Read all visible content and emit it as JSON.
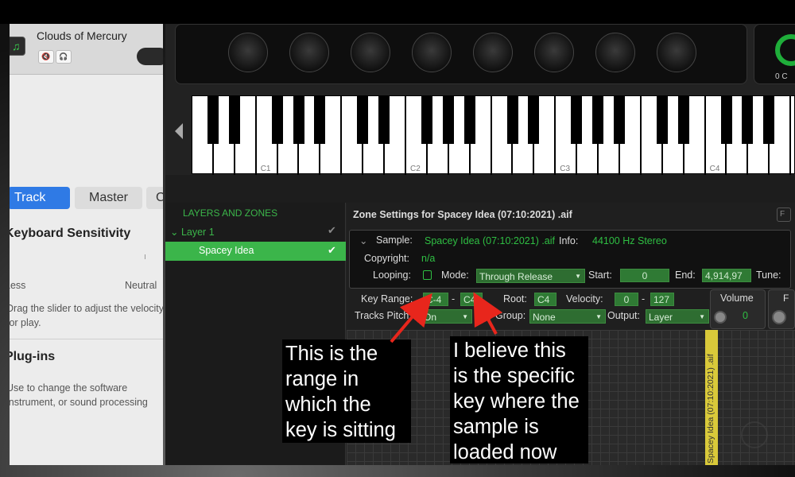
{
  "left_panel": {
    "track_name": "Clouds of Mercury",
    "mute_icon": "🔇",
    "headphones_icon": "🎧",
    "tabs": {
      "track": "Track",
      "master": "Master",
      "more": "C"
    },
    "keyboard_sensitivity": {
      "title": "Keyboard Sensitivity",
      "less": "Less",
      "neutral": "Neutral",
      "help": "Drag the slider to adjust the velocity for play."
    },
    "plugins": {
      "title": "Plug-ins",
      "help": "Use to change the software instrument, or sound processing"
    }
  },
  "keyboard": {
    "labels": [
      "C1",
      "C2",
      "C3",
      "C4"
    ],
    "side_value": "0 C"
  },
  "layers": {
    "title": "LAYERS AND ZONES",
    "layer_name": "Layer 1",
    "zone_name": "Spacey Idea",
    "check": "✔"
  },
  "zone_settings": {
    "title": "Zone Settings for Spacey Idea (07:10:2021) .aif",
    "sample_label": "Sample:",
    "sample_value": "Spacey Idea (07:10:2021) .aif",
    "info_label": "Info:",
    "info_value": "44100 Hz Stereo",
    "copyright_label": "Copyright:",
    "copyright_value": "n/a",
    "looping_label": "Looping:",
    "mode_label": "Mode:",
    "mode_value": "Through Release",
    "start_label": "Start:",
    "start_value": "0",
    "end_label": "End:",
    "end_value": "4,914,97",
    "tune_label": "Tune:",
    "key_range_label": "Key Range:",
    "key_range_low": "C-4",
    "key_range_dash": "-",
    "key_range_high": "C4",
    "root_label": "Root:",
    "root_value": "C4",
    "velocity_label": "Velocity:",
    "velocity_low": "0",
    "velocity_dash": "-",
    "velocity_high": "127",
    "volume_label": "Volume",
    "volume_value": "0",
    "volume2_label": "F",
    "tracks_pitch_label": "Tracks Pitch:",
    "tracks_pitch_value": "On",
    "key_group_label": "Key Group:",
    "key_group_value": "None",
    "output_label": "Output:",
    "output_value": "Layer",
    "zone_bar_label": "Spacey Idea (07:10:2021) .aif"
  },
  "annotations": {
    "range_note": "This is the range in which the key is sitting",
    "key_note": "I believe this is the specific key where the sample is loaded now"
  },
  "colors": {
    "green": "#2fbf43",
    "accent_blue": "#2f7ae5",
    "arrow": "#e8261c",
    "zone_bar": "#d9c93a"
  }
}
